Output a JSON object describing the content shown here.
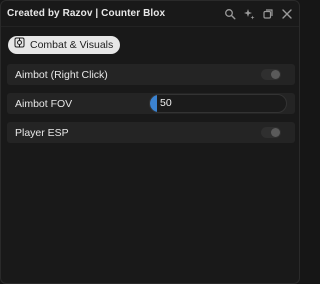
{
  "window": {
    "title": "Created by Razov | Counter Blox"
  },
  "title_icons": [
    "search-icon",
    "sparkles-icon",
    "minimize-icon",
    "close-icon"
  ],
  "tabs": [
    {
      "label": "Combat & Visuals",
      "icon": "target-icon",
      "selected": true
    }
  ],
  "settings": {
    "aimbot": {
      "label": "Aimbot (Right Click)",
      "enabled": false
    },
    "aimbot_fov": {
      "label": "Aimbot FOV",
      "value": "50",
      "fill_fraction": 0.05,
      "accent": "#3b82cf"
    },
    "player_esp": {
      "label": "Player ESP",
      "enabled": false
    }
  }
}
